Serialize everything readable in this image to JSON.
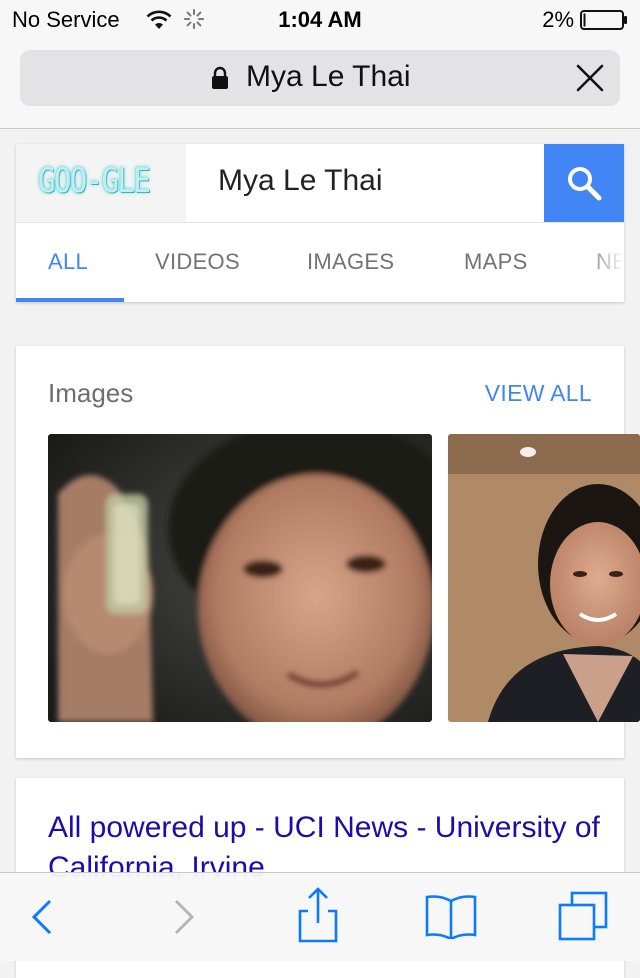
{
  "status_bar": {
    "carrier": "No Service",
    "time": "1:04 AM",
    "battery_percent": "2%"
  },
  "address_bar": {
    "text": "Mya Le Thai"
  },
  "search": {
    "logo_text": "GOO-GLE",
    "query": "Mya Le Thai",
    "tabs": [
      "ALL",
      "VIDEOS",
      "IMAGES",
      "MAPS",
      "NE"
    ],
    "active_tab": "ALL"
  },
  "images_section": {
    "heading": "Images",
    "view_all": "VIEW ALL"
  },
  "result": {
    "title": "All powered up - UCI News - University of California, Irvine"
  },
  "colors": {
    "accent": "#4285f4",
    "link": "#1a0dab",
    "ios_blue": "#0a7aff"
  }
}
